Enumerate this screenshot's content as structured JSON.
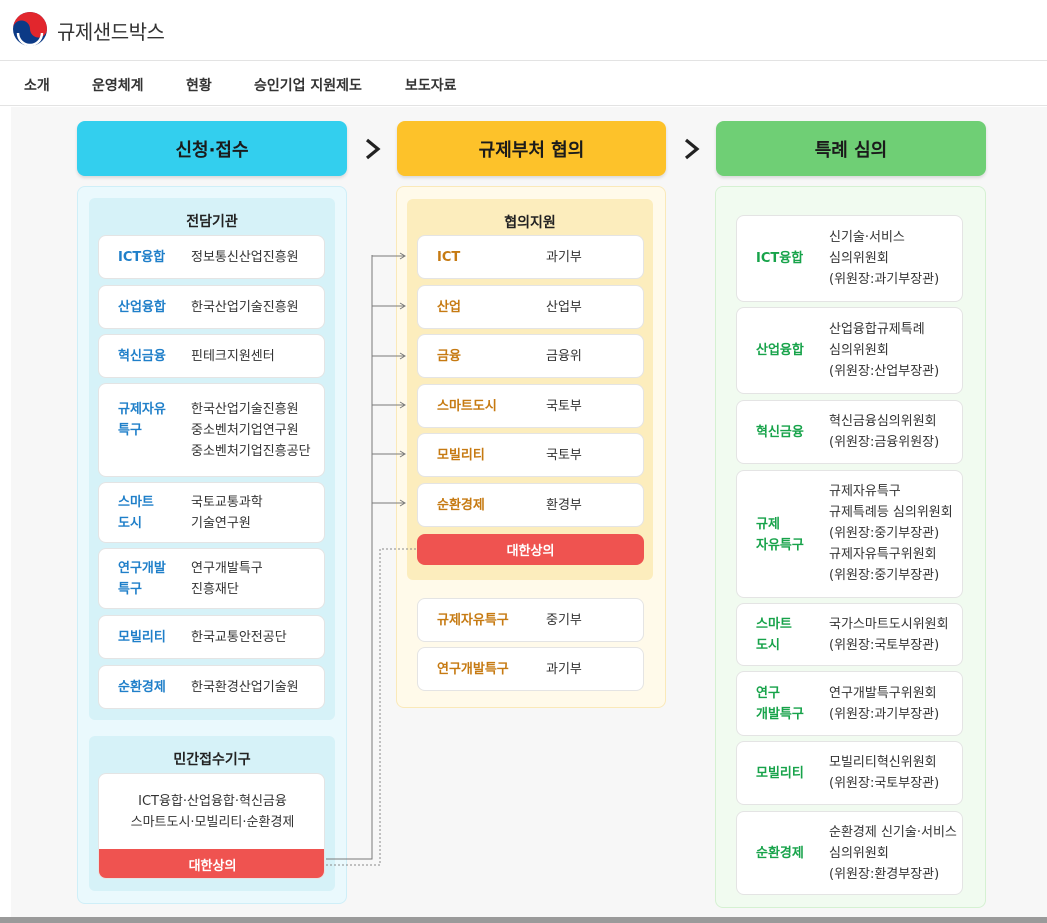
{
  "header": {
    "brand": "규제샌드박스"
  },
  "nav": {
    "items": [
      "소개",
      "운영체계",
      "현황",
      "승인기업 지원제도",
      "보도자료"
    ]
  },
  "stages": [
    {
      "title": "신청·접수"
    },
    {
      "title": "규제부처 협의"
    },
    {
      "title": "특례 심의"
    }
  ],
  "intake": {
    "title": "전담기관",
    "rows": [
      {
        "key": "ICT융합",
        "value": "정보통신산업진흥원"
      },
      {
        "key": "산업융합",
        "value": "한국산업기술진흥원"
      },
      {
        "key": "혁신금융",
        "value": "핀테크지원센터"
      },
      {
        "key": "규제자유\n특구",
        "value": "한국산업기술진흥원\n중소벤처기업연구원\n중소벤처기업진흥공단"
      },
      {
        "key": "스마트\n도시",
        "value": "국토교통과학\n기술연구원"
      },
      {
        "key": "연구개발\n특구",
        "value": "연구개발특구\n진흥재단"
      },
      {
        "key": "모빌리티",
        "value": "한국교통안전공단"
      },
      {
        "key": "순환경제",
        "value": "한국환경산업기술원"
      }
    ],
    "private": {
      "title": "민간접수기구",
      "desc": "ICT융합·산업융합·혁신금융\n스마트도시·모빌리티·순환경제",
      "bar": "대한상의"
    }
  },
  "consult": {
    "title": "협의지원",
    "rows": [
      {
        "key": "ICT",
        "value": "과기부"
      },
      {
        "key": "산업",
        "value": "산업부"
      },
      {
        "key": "금융",
        "value": "금융위"
      },
      {
        "key": "스마트도시",
        "value": "국토부"
      },
      {
        "key": "모빌리티",
        "value": "국토부"
      },
      {
        "key": "순환경제",
        "value": "환경부"
      }
    ],
    "bar": "대한상의",
    "extra": [
      {
        "key": "규제자유특구",
        "value": "중기부"
      },
      {
        "key": "연구개발특구",
        "value": "과기부"
      }
    ]
  },
  "review": {
    "rows": [
      {
        "key": "ICT융합",
        "value": "신기술·서비스\n심의위원회\n(위원장:과기부장관)"
      },
      {
        "key": "산업융합",
        "value": "산업융합규제특례\n심의위원회\n(위원장:산업부장관)"
      },
      {
        "key": "혁신금융",
        "value": "혁신금융심의위원회\n(위원장:금융위원장)"
      },
      {
        "key": "규제\n자유특구",
        "value": "규제자유특구\n규제특례등 심의위원회\n(위원장:중기부장관)\n규제자유특구위원회\n(위원장:중기부장관)"
      },
      {
        "key": "스마트\n도시",
        "value": "국가스마트도시위원회\n(위원장:국토부장관)"
      },
      {
        "key": "연구\n개발특구",
        "value": "연구개발특구위원회\n(위원장:과기부장관)"
      },
      {
        "key": "모빌리티",
        "value": "모빌리티혁신위원회\n(위원장:국토부장관)"
      },
      {
        "key": "순환경제",
        "value": "순환경제 신기술·서비스\n심의위원회\n(위원장:환경부장관)"
      }
    ]
  },
  "colors": {
    "stage1": "#33cfee",
    "stage2": "#fdc22a",
    "stage3": "#6fcf75",
    "intake_key": "#1f7fc9",
    "consult_key": "#c67a12",
    "review_key": "#17a34a",
    "alert_bar": "#ef5350"
  }
}
